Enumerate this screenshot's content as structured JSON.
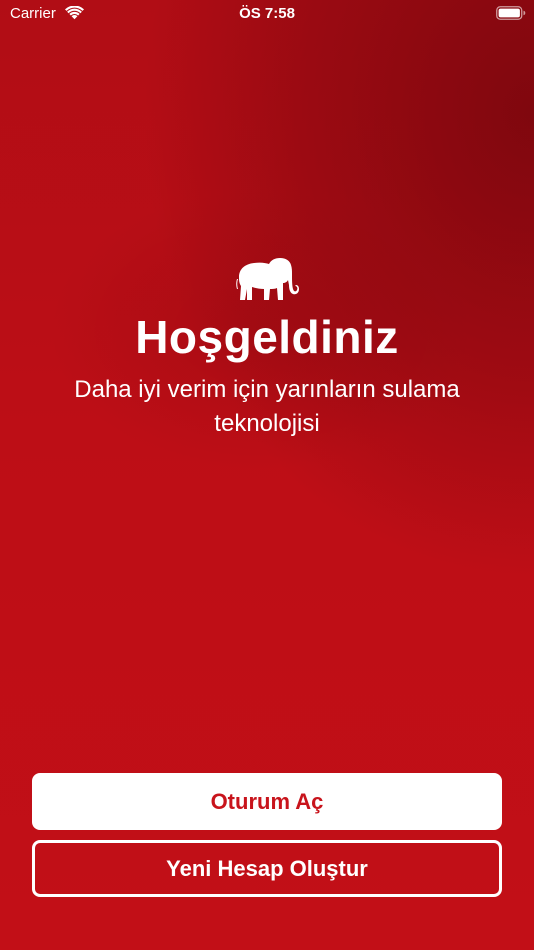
{
  "status_bar": {
    "carrier": "Carrier",
    "time": "ÖS 7:58",
    "icons": [
      "wifi-icon",
      "battery-icon"
    ]
  },
  "hero": {
    "logo_icon": "elephant-icon",
    "title": "Hoşgeldiniz",
    "tagline": "Daha iyi verim için yarınların sulama teknolojisi"
  },
  "actions": {
    "signin_label": "Oturum Aç",
    "register_label": "Yeni Hesap Oluştur"
  },
  "colors": {
    "background": "#c20f17",
    "background_dark": "#8c0a10",
    "signin_text": "#c8141c",
    "white": "#ffffff"
  }
}
